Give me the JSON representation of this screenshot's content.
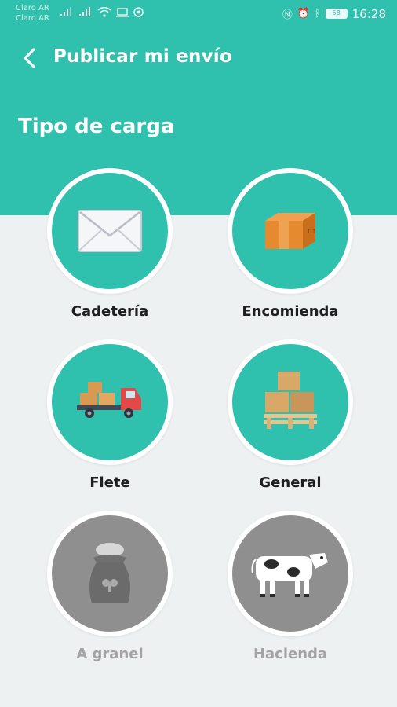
{
  "status_bar": {
    "carrier_1": "Claro AR",
    "carrier_2": "Claro AR",
    "battery": "58",
    "time": "16:28"
  },
  "header": {
    "title": "Publicar mi envío",
    "back_icon": "chevron-left-icon"
  },
  "section": {
    "title": "Tipo de carga"
  },
  "options": [
    {
      "label": "Cadetería",
      "icon": "envelope-icon",
      "enabled": true
    },
    {
      "label": "Encomienda",
      "icon": "package-icon",
      "enabled": true
    },
    {
      "label": "Flete",
      "icon": "truck-icon",
      "enabled": true
    },
    {
      "label": "General",
      "icon": "pallet-boxes-icon",
      "enabled": true
    },
    {
      "label": "A granel",
      "icon": "grain-sack-icon",
      "enabled": false
    },
    {
      "label": "Hacienda",
      "icon": "cow-icon",
      "enabled": false
    }
  ],
  "colors": {
    "primary": "#2fc1ae",
    "background": "#eef1f1",
    "disabled": "#8f8f8f"
  }
}
